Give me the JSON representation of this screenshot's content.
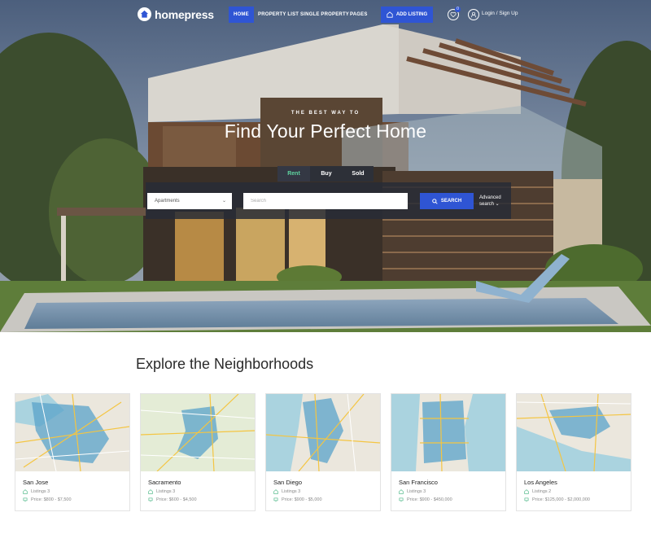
{
  "brand": {
    "name": "homepress"
  },
  "nav": {
    "items": [
      {
        "label": "HOME",
        "active": true
      },
      {
        "label": "PROPERTY LIST",
        "active": false
      },
      {
        "label": "SINGLE PROPERTY",
        "active": false
      },
      {
        "label": "PAGES",
        "active": false
      }
    ],
    "add_listing": "ADD LISTING",
    "favorites_count": "0",
    "login": "Login / Sign Up"
  },
  "hero": {
    "eyebrow": "THE BEST WAY TO",
    "headline": "Find Your Perfect Home",
    "tabs": [
      {
        "label": "Rent",
        "active": true
      },
      {
        "label": "Buy",
        "active": false
      },
      {
        "label": "Sold",
        "active": false
      }
    ],
    "search": {
      "type_value": "Apartments",
      "placeholder": "Search",
      "button": "SEARCH",
      "advanced_line1": "Advanced",
      "advanced_line2": "search ⌄"
    }
  },
  "neighborhoods": {
    "title": "Explore the Neighborhoods",
    "cards": [
      {
        "name": "San Jose",
        "listings": "Listings 3",
        "price": "Price: $800 - $7,500"
      },
      {
        "name": "Sacramento",
        "listings": "Listings 3",
        "price": "Price: $600 - $4,500"
      },
      {
        "name": "San Diego",
        "listings": "Listings 3",
        "price": "Price: $900 - $5,000"
      },
      {
        "name": "San Francisco",
        "listings": "Listings 3",
        "price": "Price: $900 - $450,000"
      },
      {
        "name": "Los Angeles",
        "listings": "Listings 2",
        "price": "Price: $125,000 - $2,000,000"
      }
    ]
  },
  "colors": {
    "accent": "#2f55d4",
    "active_tab_text": "#5fd4a0",
    "map_region": "#5aa3c9"
  }
}
